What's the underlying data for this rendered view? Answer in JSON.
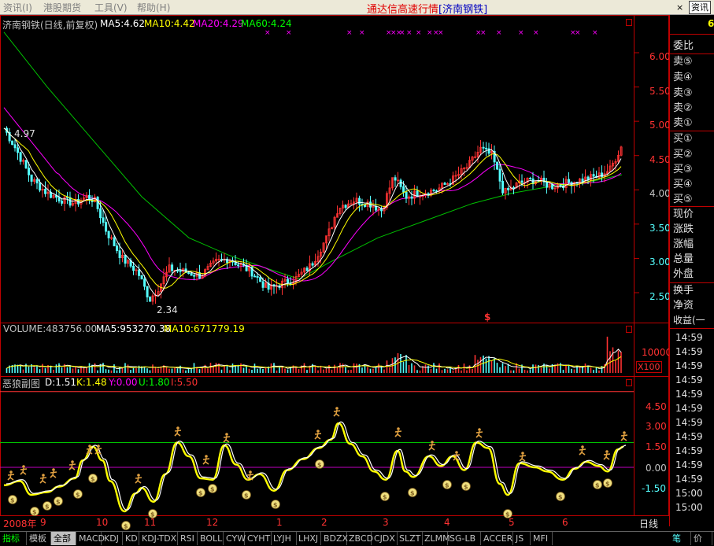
{
  "menu": {
    "items": [
      "资讯(I)",
      "港股期货",
      "工具(V)",
      "帮助(H)"
    ],
    "title_prefix": "通达信高速行情",
    "title_stock": "[济南钢铁]",
    "info_button": "资讯",
    "close": "×"
  },
  "price_panel": {
    "title": "济南钢铁(日线,前复权)",
    "ma5": "MA5:4.62",
    "ma10": "MA10:4.42",
    "ma20": "MA20:4.29",
    "ma60": "MA60:4.24",
    "high_label": "4.97",
    "low_label": "2.34",
    "marker": "$",
    "y_ticks": [
      "6.00",
      "5.50",
      "5.00",
      "4.50",
      "4.00",
      "3.50",
      "3.00",
      "2.50"
    ]
  },
  "volume_panel": {
    "volume": "VOLUME:483756.00",
    "ma5": "MA5:953270.38",
    "ma10": "MA10:671779.19",
    "y_tick": "10000",
    "unit": "X100"
  },
  "indicator_panel": {
    "title": "恶狼副图",
    "d": "D:1.51",
    "k": "K:1.48",
    "y": "Y:0.00",
    "u": "U:1.80",
    "i": "I:5.50",
    "y_ticks": [
      "4.50",
      "3.00",
      "1.50",
      "0.00",
      "-1.50"
    ]
  },
  "x_axis": {
    "year": "2008年",
    "months": [
      "9",
      "10",
      "11",
      "12",
      "1",
      "2",
      "3",
      "4",
      "5",
      "6"
    ]
  },
  "right_panel": {
    "top_value": "6",
    "order_labels": [
      "委比",
      "卖⑤",
      "卖④",
      "卖③",
      "卖②",
      "卖①",
      "买①",
      "买②",
      "买③",
      "买④",
      "买⑤"
    ],
    "stat_labels": [
      "现价",
      "涨跌",
      "涨幅",
      "总量",
      "外盘",
      "换手",
      "净资",
      "收益(一"
    ],
    "times": [
      "14:59",
      "14:59",
      "14:59",
      "14:59",
      "14:59",
      "14:59",
      "14:59",
      "14:59",
      "14:59",
      "14:59",
      "14:59",
      "15:00",
      "15:00"
    ],
    "period": "日线"
  },
  "tabs": [
    "指标",
    "模板",
    "全部",
    "MACD",
    "KDJ",
    "KD",
    "KDJ-TDX",
    "RSI",
    "BOLL",
    "CYW",
    "CYHT",
    "LYJH",
    "LHXJ",
    "BDZX",
    "ZBCD",
    "CJDX",
    "SLZT",
    "ZLMM",
    "SG-LB",
    "ACCER",
    "JS",
    "MFI"
  ],
  "tabs_right": [
    "笔",
    "价"
  ],
  "colors": {
    "up": "#ff3232",
    "down": "#54ffff",
    "ma5": "#ffffff",
    "ma10": "#ffff00",
    "ma20": "#ff00ff",
    "ma60": "#00c000"
  }
}
